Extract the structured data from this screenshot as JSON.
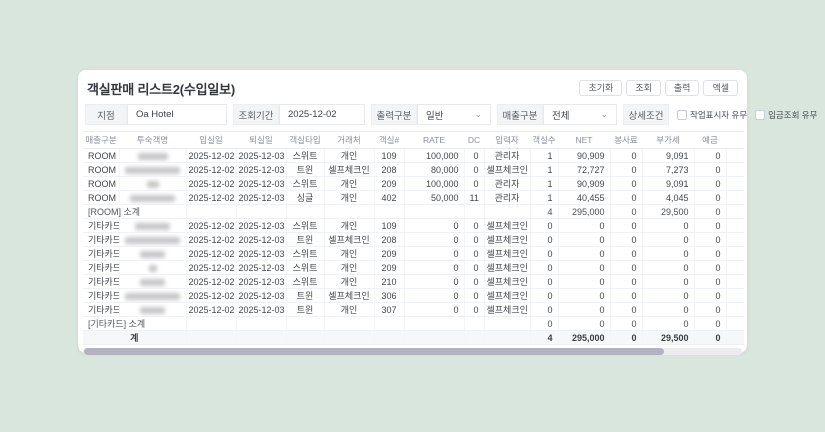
{
  "page": {
    "title": "객실판매 리스트2(수입일보)"
  },
  "toolbar": {
    "reset_label": "초기화",
    "search_label": "조회",
    "print_label": "출력",
    "excel_label": "엑셀"
  },
  "filters": {
    "branch_label": "지점",
    "branch_value": "Oa Hotel",
    "period_label": "조회기간",
    "period_value": "2025-12-02",
    "output_label": "출력구분",
    "output_value": "일반",
    "sales_label": "매출구분",
    "sales_value": "전체",
    "detail_label": "상세조건",
    "checkboxes": [
      {
        "label": "작업표시자 유무",
        "checked": false
      },
      {
        "label": "입금조회 유무",
        "checked": false
      }
    ]
  },
  "table": {
    "columns": [
      "매출구분",
      "투숙객명",
      "입실일",
      "퇴실일",
      "객실타입",
      "거래처",
      "객실#",
      "RATE",
      "DC",
      "입력자",
      "객실수",
      "NET",
      "봉사료",
      "부가세",
      "예금",
      ""
    ],
    "sections": [
      {
        "name": "ROOM",
        "rows": [
          {
            "sale": "ROOM",
            "guest_w": 30,
            "checkin": "2025-12-02",
            "checkout": "2025-12-03",
            "rtype": "스위트",
            "client": "개인",
            "rno": "109",
            "rate": "100,000",
            "dc": "0",
            "by": "관리자",
            "cnt": "1",
            "net": "90,909",
            "svc": "0",
            "vat": "9,091",
            "dep": "0"
          },
          {
            "sale": "ROOM",
            "guest_w": 55,
            "checkin": "2025-12-02",
            "checkout": "2025-12-03",
            "rtype": "트윈",
            "client": "셀프체크인",
            "rno": "208",
            "rate": "80,000",
            "dc": "0",
            "by": "셀프체크인",
            "cnt": "1",
            "net": "72,727",
            "svc": "0",
            "vat": "7,273",
            "dep": "0"
          },
          {
            "sale": "ROOM",
            "guest_w": 12,
            "checkin": "2025-12-02",
            "checkout": "2025-12-03",
            "rtype": "스위트",
            "client": "개인",
            "rno": "209",
            "rate": "100,000",
            "dc": "0",
            "by": "관리자",
            "cnt": "1",
            "net": "90,909",
            "svc": "0",
            "vat": "9,091",
            "dep": "0"
          },
          {
            "sale": "ROOM",
            "guest_w": 45,
            "checkin": "2025-12-02",
            "checkout": "2025-12-03",
            "rtype": "싱글",
            "client": "개인",
            "rno": "402",
            "rate": "50,000",
            "dc": "11",
            "by": "관리자",
            "cnt": "1",
            "net": "40,455",
            "svc": "0",
            "vat": "4,045",
            "dep": "0"
          }
        ],
        "subtotal": {
          "label": "[ROOM] 소계",
          "cnt": "4",
          "net": "295,000",
          "svc": "0",
          "vat": "29,500",
          "dep": "0"
        }
      },
      {
        "name": "기타카드",
        "rows": [
          {
            "sale": "기타카드",
            "guest_w": 35,
            "checkin": "2025-12-02",
            "checkout": "2025-12-03",
            "rtype": "스위트",
            "client": "개인",
            "rno": "109",
            "rate": "0",
            "dc": "0",
            "by": "셀프체크인",
            "cnt": "0",
            "net": "0",
            "svc": "0",
            "vat": "0",
            "dep": "0"
          },
          {
            "sale": "기타카드",
            "guest_w": 55,
            "checkin": "2025-12-02",
            "checkout": "2025-12-03",
            "rtype": "트윈",
            "client": "셀프체크인",
            "rno": "208",
            "rate": "0",
            "dc": "0",
            "by": "셀프체크인",
            "cnt": "0",
            "net": "0",
            "svc": "0",
            "vat": "0",
            "dep": "0"
          },
          {
            "sale": "기타카드",
            "guest_w": 25,
            "checkin": "2025-12-02",
            "checkout": "2025-12-03",
            "rtype": "스위트",
            "client": "개인",
            "rno": "209",
            "rate": "0",
            "dc": "0",
            "by": "셀프체크인",
            "cnt": "0",
            "net": "0",
            "svc": "0",
            "vat": "0",
            "dep": "0"
          },
          {
            "sale": "기타카드",
            "guest_w": 8,
            "checkin": "2025-12-02",
            "checkout": "2025-12-03",
            "rtype": "스위트",
            "client": "개인",
            "rno": "209",
            "rate": "0",
            "dc": "0",
            "by": "셀프체크인",
            "cnt": "0",
            "net": "0",
            "svc": "0",
            "vat": "0",
            "dep": "0"
          },
          {
            "sale": "기타카드",
            "guest_w": 25,
            "checkin": "2025-12-02",
            "checkout": "2025-12-03",
            "rtype": "스위트",
            "client": "개인",
            "rno": "210",
            "rate": "0",
            "dc": "0",
            "by": "셀프체크인",
            "cnt": "0",
            "net": "0",
            "svc": "0",
            "vat": "0",
            "dep": "0"
          },
          {
            "sale": "기타카드",
            "guest_w": 55,
            "checkin": "2025-12-02",
            "checkout": "2025-12-03",
            "rtype": "트윈",
            "client": "셀프체크인",
            "rno": "306",
            "rate": "0",
            "dc": "0",
            "by": "셀프체크인",
            "cnt": "0",
            "net": "0",
            "svc": "0",
            "vat": "0",
            "dep": "0"
          },
          {
            "sale": "기타카드",
            "guest_w": 25,
            "checkin": "2025-12-02",
            "checkout": "2025-12-03",
            "rtype": "트윈",
            "client": "개인",
            "rno": "307",
            "rate": "0",
            "dc": "0",
            "by": "셀프체크인",
            "cnt": "0",
            "net": "0",
            "svc": "0",
            "vat": "0",
            "dep": "0"
          }
        ],
        "subtotal": {
          "label": "[기타카드] 소계",
          "cnt": "0",
          "net": "0",
          "svc": "0",
          "vat": "0",
          "dep": "0"
        }
      }
    ],
    "total": {
      "label": "계",
      "cnt": "4",
      "net": "295,000",
      "svc": "0",
      "vat": "29,500",
      "dep": "0"
    }
  },
  "colors": {
    "background": "#d9e6de",
    "card": "#ffffff",
    "scrollbar_thumb": "#b2b3bf"
  }
}
